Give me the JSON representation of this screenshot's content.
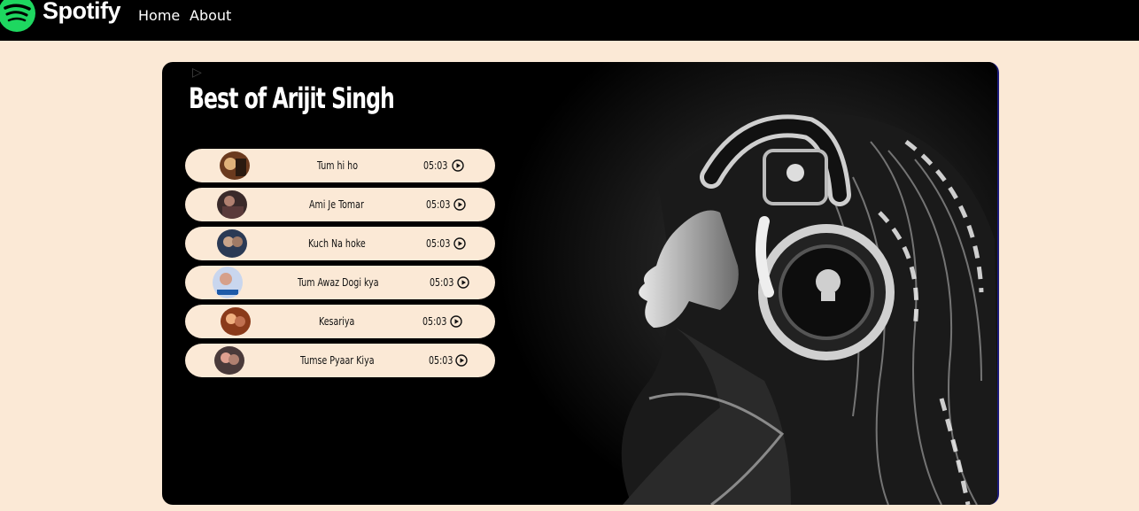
{
  "nav": {
    "brand": "Spotify",
    "links": [
      "Home",
      "About"
    ]
  },
  "playlist": {
    "title": "Best of Arijit Singh",
    "songs": [
      {
        "name": "Tum hi ho",
        "duration": "05:03"
      },
      {
        "name": "Ami Je Tomar",
        "duration": "05:03"
      },
      {
        "name": "Kuch Na hoke",
        "duration": "05:03"
      },
      {
        "name": "Tum Awaz Dogi kya",
        "duration": "05:03"
      },
      {
        "name": "Kesariya",
        "duration": "05:03"
      },
      {
        "name": "Tumse Pyaar Kiya",
        "duration": "05:03"
      }
    ]
  },
  "colors": {
    "background": "#fbe9d6",
    "navbar": "#000000",
    "brand_green": "#1ed760",
    "card": "#000000",
    "song_pill": "#fbe9d6"
  },
  "icons": {
    "play": "play-circle-icon",
    "logo": "spotify-logo-icon"
  }
}
